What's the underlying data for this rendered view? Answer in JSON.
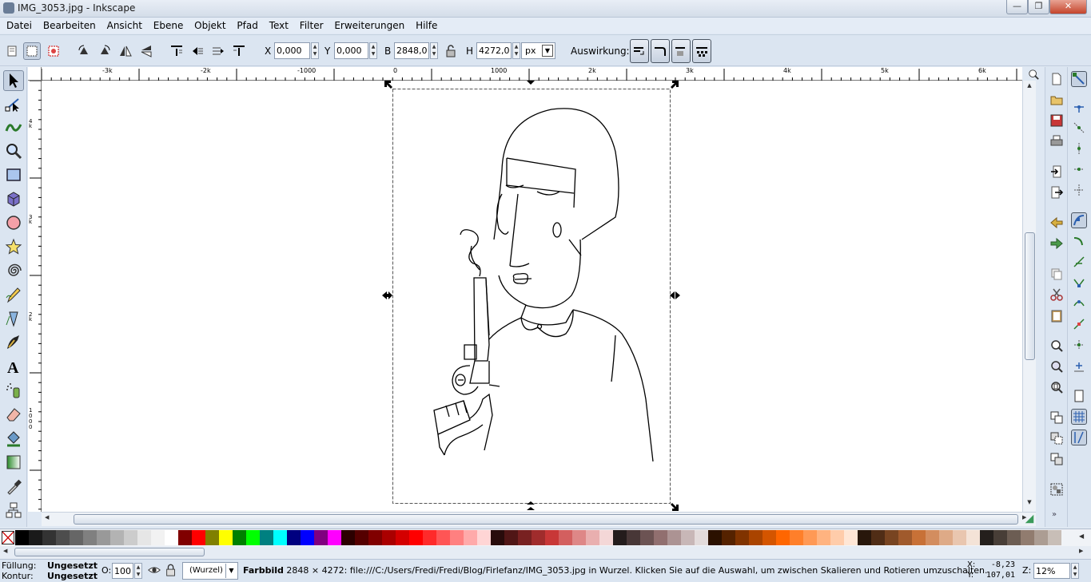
{
  "window": {
    "title": "IMG_3053.jpg - Inkscape",
    "min": "—",
    "max": "❐",
    "close": "✕"
  },
  "menu": [
    "Datei",
    "Bearbeiten",
    "Ansicht",
    "Ebene",
    "Objekt",
    "Pfad",
    "Text",
    "Filter",
    "Erweiterungen",
    "Hilfe"
  ],
  "toolctl": {
    "x_label": "X",
    "x_value": "0,000",
    "y_label": "Y",
    "y_value": "0,000",
    "w_label": "B",
    "w_value": "2848,00",
    "h_label": "H",
    "h_value": "4272,00",
    "unit": "px",
    "affect_label": "Auswirkung:"
  },
  "ruler": {
    "h_ticks": [
      "-3k",
      "-2k",
      "-1000",
      "0",
      "1000",
      "2k",
      "3k",
      "4k",
      "5k",
      "6k"
    ],
    "v_ticks": [
      "4 k",
      "3 k",
      "2 k",
      "1 0 0 0"
    ]
  },
  "palette": [
    "#000000",
    "#1a1a1a",
    "#333333",
    "#4d4d4d",
    "#666666",
    "#808080",
    "#999999",
    "#b3b3b3",
    "#cccccc",
    "#e6e6e6",
    "#f2f2f2",
    "#ffffff",
    "#800000",
    "#ff0000",
    "#808000",
    "#ffff00",
    "#008000",
    "#00ff00",
    "#008080",
    "#00ffff",
    "#000080",
    "#0000ff",
    "#800080",
    "#ff00ff",
    "#2b0000",
    "#550000",
    "#800000",
    "#aa0000",
    "#d40000",
    "#ff0000",
    "#ff2a2a",
    "#ff5555",
    "#ff8080",
    "#ffaaaa",
    "#ffd5d5",
    "#280b0b",
    "#501616",
    "#782121",
    "#a02c2c",
    "#c83737",
    "#d35f5f",
    "#de8787",
    "#e9afaf",
    "#f4d7d7",
    "#241c1c",
    "#483737",
    "#6c5353",
    "#916f6f",
    "#ac9393",
    "#c8b7b7",
    "#e3dbdb",
    "#2b1100",
    "#552200",
    "#803300",
    "#aa4400",
    "#d45500",
    "#ff6600",
    "#ff7f2a",
    "#ff9955",
    "#ffb380",
    "#ffccaa",
    "#ffe6d5",
    "#28170b",
    "#502d16",
    "#784421",
    "#a05a2c",
    "#c87137",
    "#d38d5f",
    "#deaa87",
    "#e9c6af",
    "#f4e3d7",
    "#241f1c",
    "#483e37",
    "#6c5d53",
    "#917c6f",
    "#ac9d93",
    "#c8beb7"
  ],
  "status": {
    "fill_label": "Füllung:",
    "fill_value": "Ungesetzt",
    "stroke_label": "Kontur:",
    "stroke_value": "Ungesetzt",
    "opacity_label": "O:",
    "opacity_value": "100",
    "layer": "(Wurzel)",
    "message_bold": "Farbbild",
    "message": " 2848 × 4272: file:///C:/Users/Fredi/Fredi/Blog/Firlefanz/IMG_3053.jpg in Wurzel. Klicken Sie auf die Auswahl, um zwischen Skalieren und Rotieren umzuschalten.",
    "x_label": "X:",
    "x_value": "-8,23",
    "y_label": "Y:",
    "y_value": "107,01",
    "z_label": "Z:",
    "zoom": "12%"
  }
}
